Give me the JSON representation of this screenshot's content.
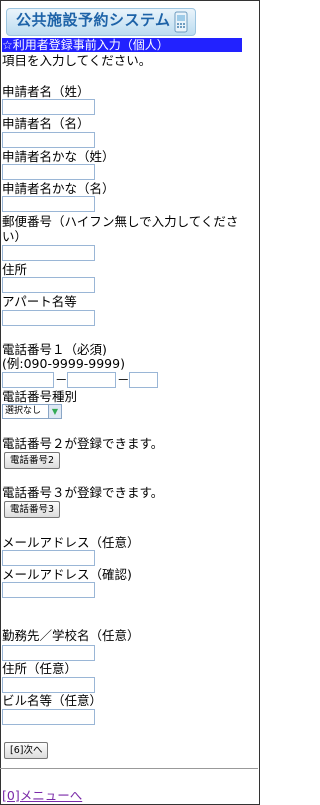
{
  "header": {
    "logo_text": "公共施設予約システム",
    "title_bar": "☆利用者登録事前入力（個人）"
  },
  "instructions": "項目を入力してください。",
  "fields": {
    "last_name": "申請者名（姓）",
    "first_name": "申請者名（名）",
    "last_name_kana": "申請者名かな（姓）",
    "first_name_kana": "申請者名かな（名）",
    "postal_code": "郵便番号（ハイフン無しで入力してください）",
    "address": "住所",
    "apartment": "アパート名等",
    "phone1": "電話番号１（必須)",
    "phone1_example": "(例:090-9999-9999)",
    "phone_separator": "－",
    "phone_type": "電話番号種別",
    "phone_type_selected": "選択なし",
    "phone2_note": "電話番号２が登録できます。",
    "phone2_button": "電話番号2",
    "phone3_note": "電話番号３が登録できます。",
    "phone3_button": "電話番号3",
    "email": "メールアドレス（任意）",
    "email_confirm": "メールアドレス（確認)",
    "workplace": "勤務先／学校名（任意）",
    "work_address": "住所（任意）",
    "building": "ビル名等（任意）"
  },
  "actions": {
    "next_button": "[6]次へ",
    "menu_link": "[0]メニューへ"
  },
  "colors": {
    "title_bar_bg": "#2222ff",
    "link": "#7a2aa8",
    "input_border": "#9ab6d6"
  }
}
